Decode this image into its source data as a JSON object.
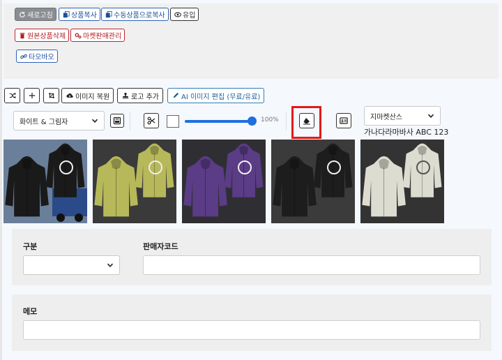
{
  "top_buttons": {
    "refresh": "새로고침",
    "copy_product": "상품복사",
    "manual_copy": "수동상품으로복사",
    "inflow": "유입",
    "delete_original": "원본상품삭제",
    "market_manage": "마켓판매관리",
    "taobao": "타오바오"
  },
  "toolbar": {
    "restore_image": "이미지 복원",
    "add_logo": "로고 추가",
    "ai_edit": "AI 이미지 편집 (무료/유료)"
  },
  "editor": {
    "background_select": "화이트 & 그림자",
    "opacity_label": "100%",
    "opacity_value": 100,
    "font_select": "지마켓산스",
    "font_preview": "가나다라마바사 ABC 123"
  },
  "images": [
    {
      "name": "black jacket on truck",
      "bg": "#6a7f9a",
      "jacket": "#1a1a1a"
    },
    {
      "name": "olive jacket",
      "bg": "#3a3a3a",
      "jacket": "#b7b85a"
    },
    {
      "name": "purple jacket",
      "bg": "#2f2f33",
      "jacket": "#5b3c86"
    },
    {
      "name": "black jacket",
      "bg": "#3b3b3b",
      "jacket": "#1d1d1d"
    },
    {
      "name": "cream jacket",
      "bg": "#333333",
      "jacket": "#dcdcd0"
    }
  ],
  "form": {
    "category_label": "구분",
    "seller_code_label": "판매자코드",
    "memo_label": "메모"
  },
  "colors": {
    "accent_blue": "#2f63b8",
    "danger_red": "#c0272d",
    "highlight_red": "#e01b1b",
    "slider_blue": "#1e6fe0"
  }
}
